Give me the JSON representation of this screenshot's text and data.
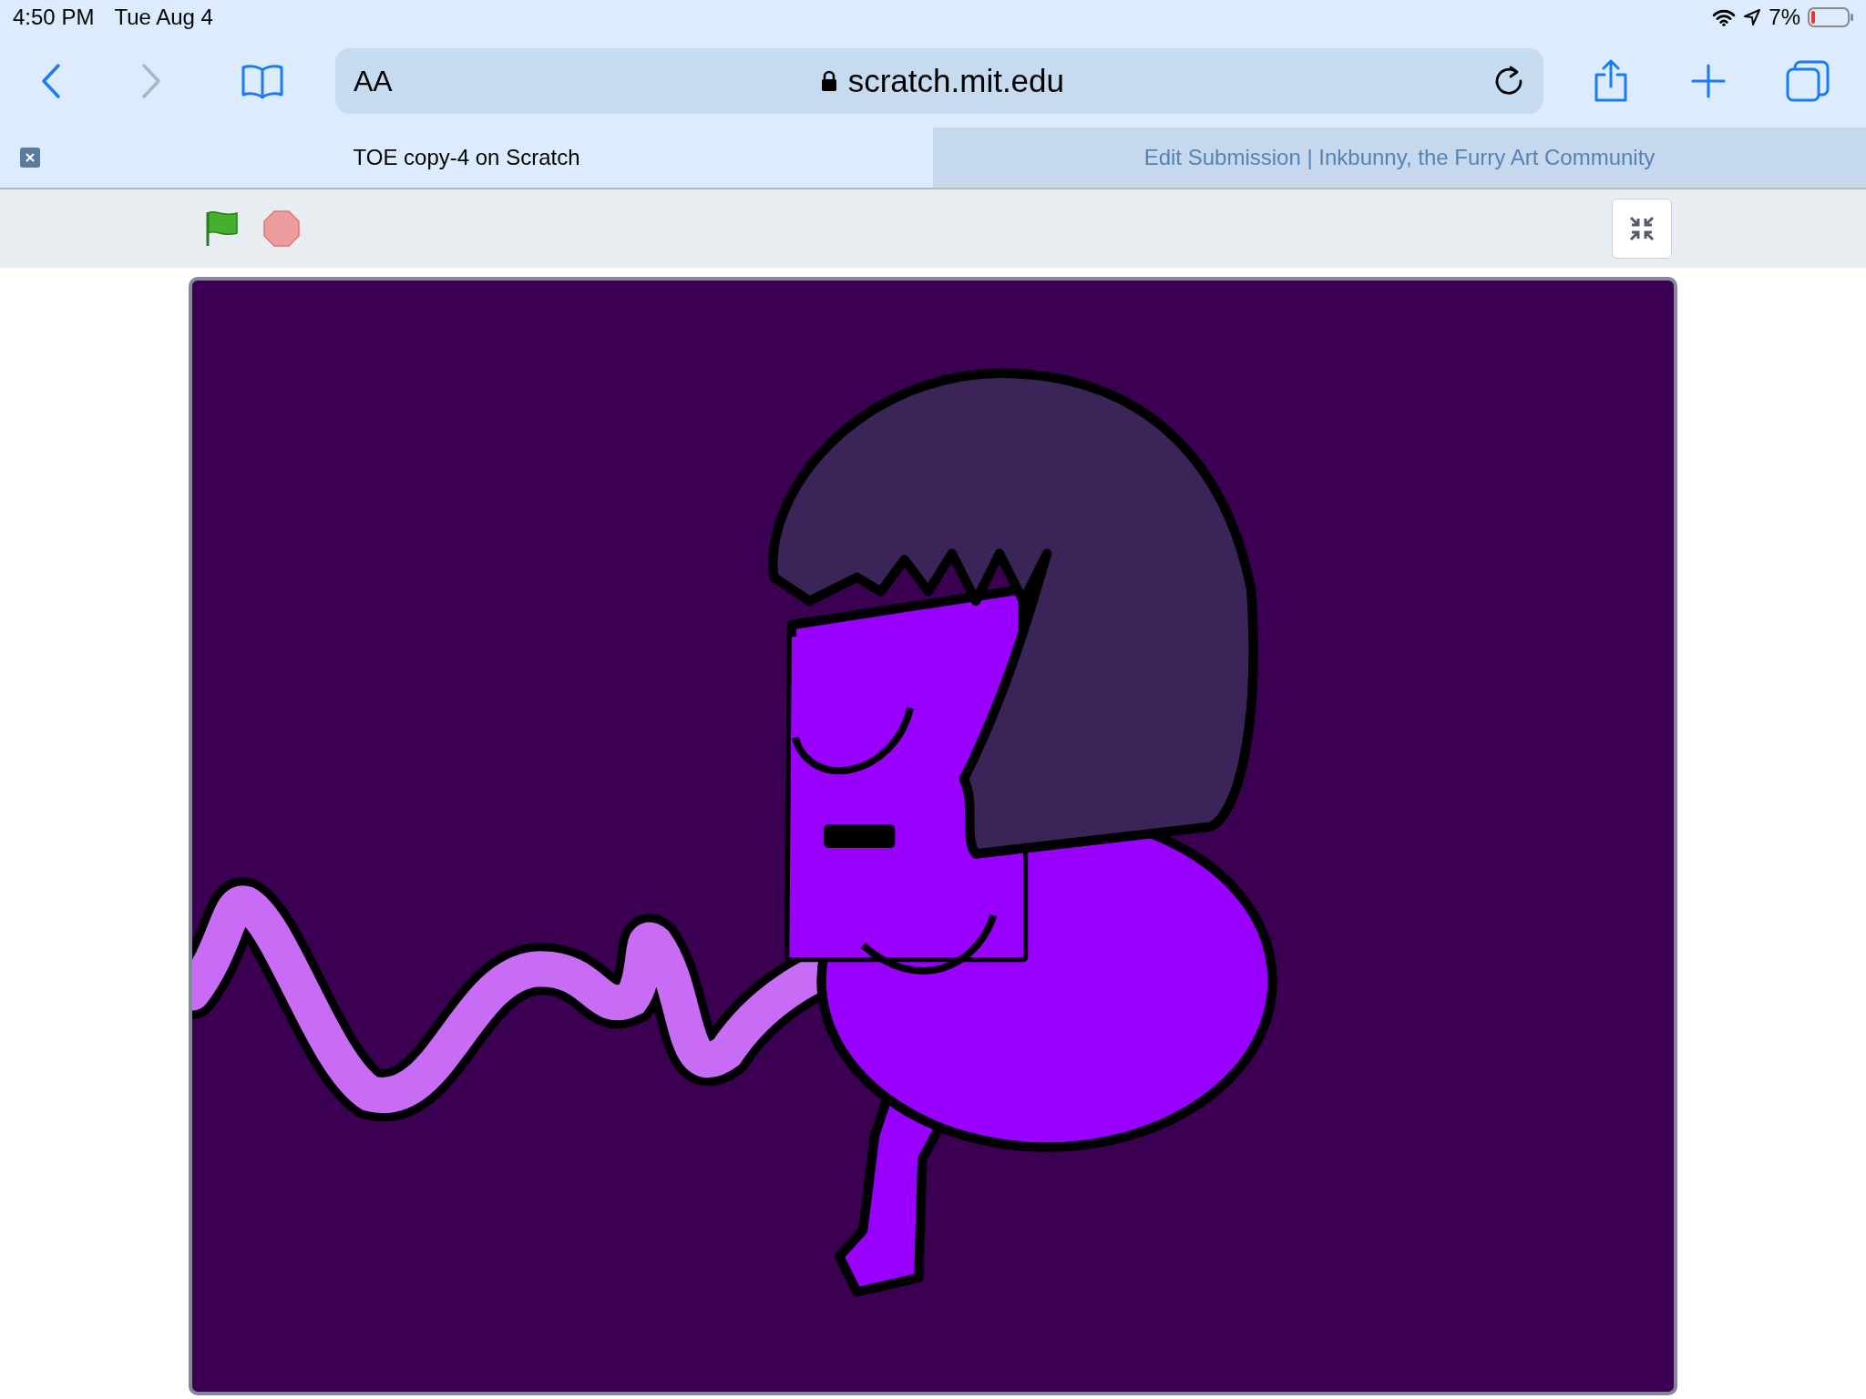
{
  "status_bar": {
    "time": "4:50 PM",
    "date": "Tue Aug 4",
    "battery": "7%"
  },
  "toolbar": {
    "reader_button": "AA",
    "address": "scratch.mit.edu"
  },
  "tabs": [
    {
      "title": "TOE copy-4 on Scratch",
      "selected": true
    },
    {
      "title": "Edit Submission | Inkbunny, the Furry Art Community",
      "selected": false
    }
  ]
}
